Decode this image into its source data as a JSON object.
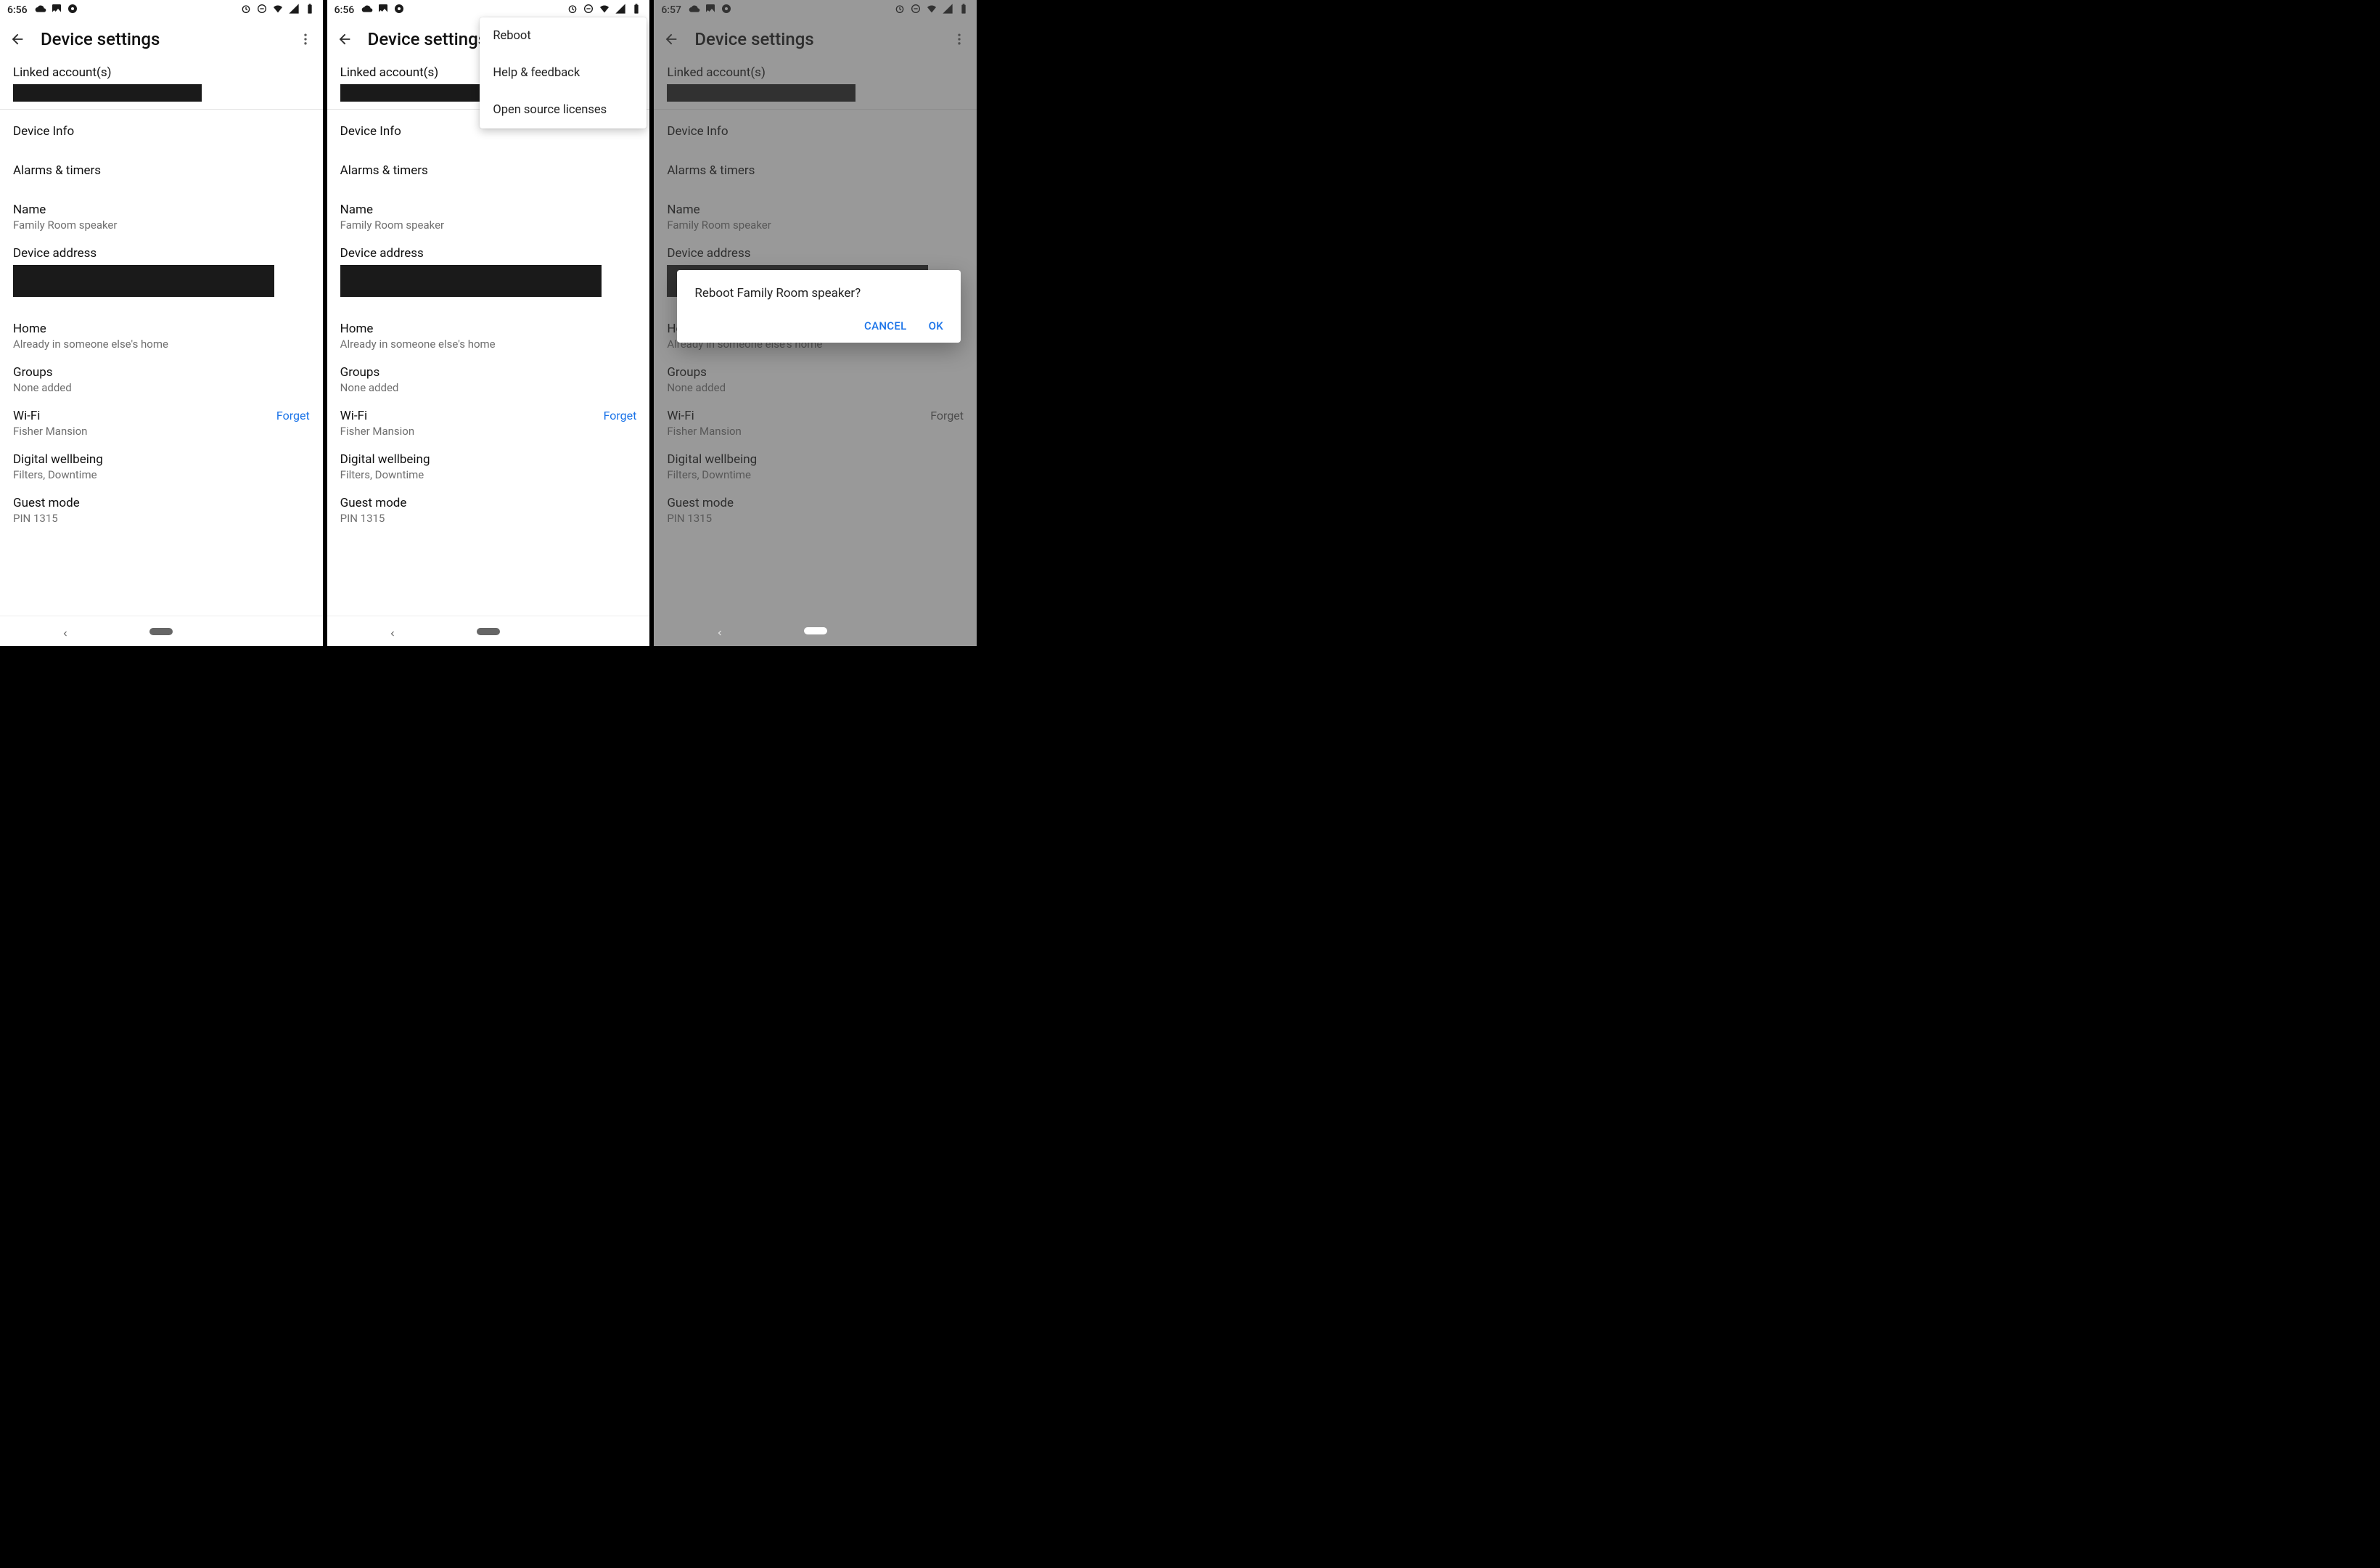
{
  "screens": [
    {
      "statusbar": {
        "time": "6:56"
      },
      "header": {
        "title": "Device settings"
      },
      "linked_accounts": {
        "label": "Linked account(s)"
      },
      "device_info": "Device Info",
      "alarms": "Alarms & timers",
      "name": {
        "label": "Name",
        "value": "Family Room speaker"
      },
      "device_address": "Device address",
      "home": {
        "label": "Home",
        "value": "Already in someone else's home"
      },
      "groups": {
        "label": "Groups",
        "value": "None added"
      },
      "wifi": {
        "label": "Wi-Fi",
        "value": "Fisher Mansion",
        "action": "Forget"
      },
      "digital_wellbeing": {
        "label": "Digital wellbeing",
        "value": "Filters, Downtime"
      },
      "guest_mode": {
        "label": "Guest mode",
        "value": "PIN 1315"
      }
    },
    {
      "statusbar": {
        "time": "6:56"
      },
      "header": {
        "title": "Device settings"
      },
      "menu": {
        "items": [
          "Reboot",
          "Help & feedback",
          "Open source licenses"
        ]
      },
      "linked_accounts": {
        "label": "Linked account(s)"
      },
      "device_info": "Device Info",
      "alarms": "Alarms & timers",
      "name": {
        "label": "Name",
        "value": "Family Room speaker"
      },
      "device_address": "Device address",
      "home": {
        "label": "Home",
        "value": "Already in someone else's home"
      },
      "groups": {
        "label": "Groups",
        "value": "None added"
      },
      "wifi": {
        "label": "Wi-Fi",
        "value": "Fisher Mansion",
        "action": "Forget"
      },
      "digital_wellbeing": {
        "label": "Digital wellbeing",
        "value": "Filters, Downtime"
      },
      "guest_mode": {
        "label": "Guest mode",
        "value": "PIN 1315"
      }
    },
    {
      "statusbar": {
        "time": "6:57"
      },
      "header": {
        "title": "Device settings"
      },
      "dialog": {
        "title": "Reboot Family Room speaker?",
        "cancel": "CANCEL",
        "ok": "OK"
      },
      "linked_accounts": {
        "label": "Linked account(s)"
      },
      "device_info": "Device Info",
      "alarms": "Alarms & timers",
      "name": {
        "label": "Name",
        "value": "Family Room speaker"
      },
      "device_address": "Device address",
      "home": {
        "label": "Home",
        "value": "Already in someone else's home"
      },
      "groups": {
        "label": "Groups",
        "value": "None added"
      },
      "wifi": {
        "label": "Wi-Fi",
        "value": "Fisher Mansion",
        "action": "Forget"
      },
      "digital_wellbeing": {
        "label": "Digital wellbeing",
        "value": "Filters, Downtime"
      },
      "guest_mode": {
        "label": "Guest mode",
        "value": "PIN 1315"
      }
    }
  ]
}
